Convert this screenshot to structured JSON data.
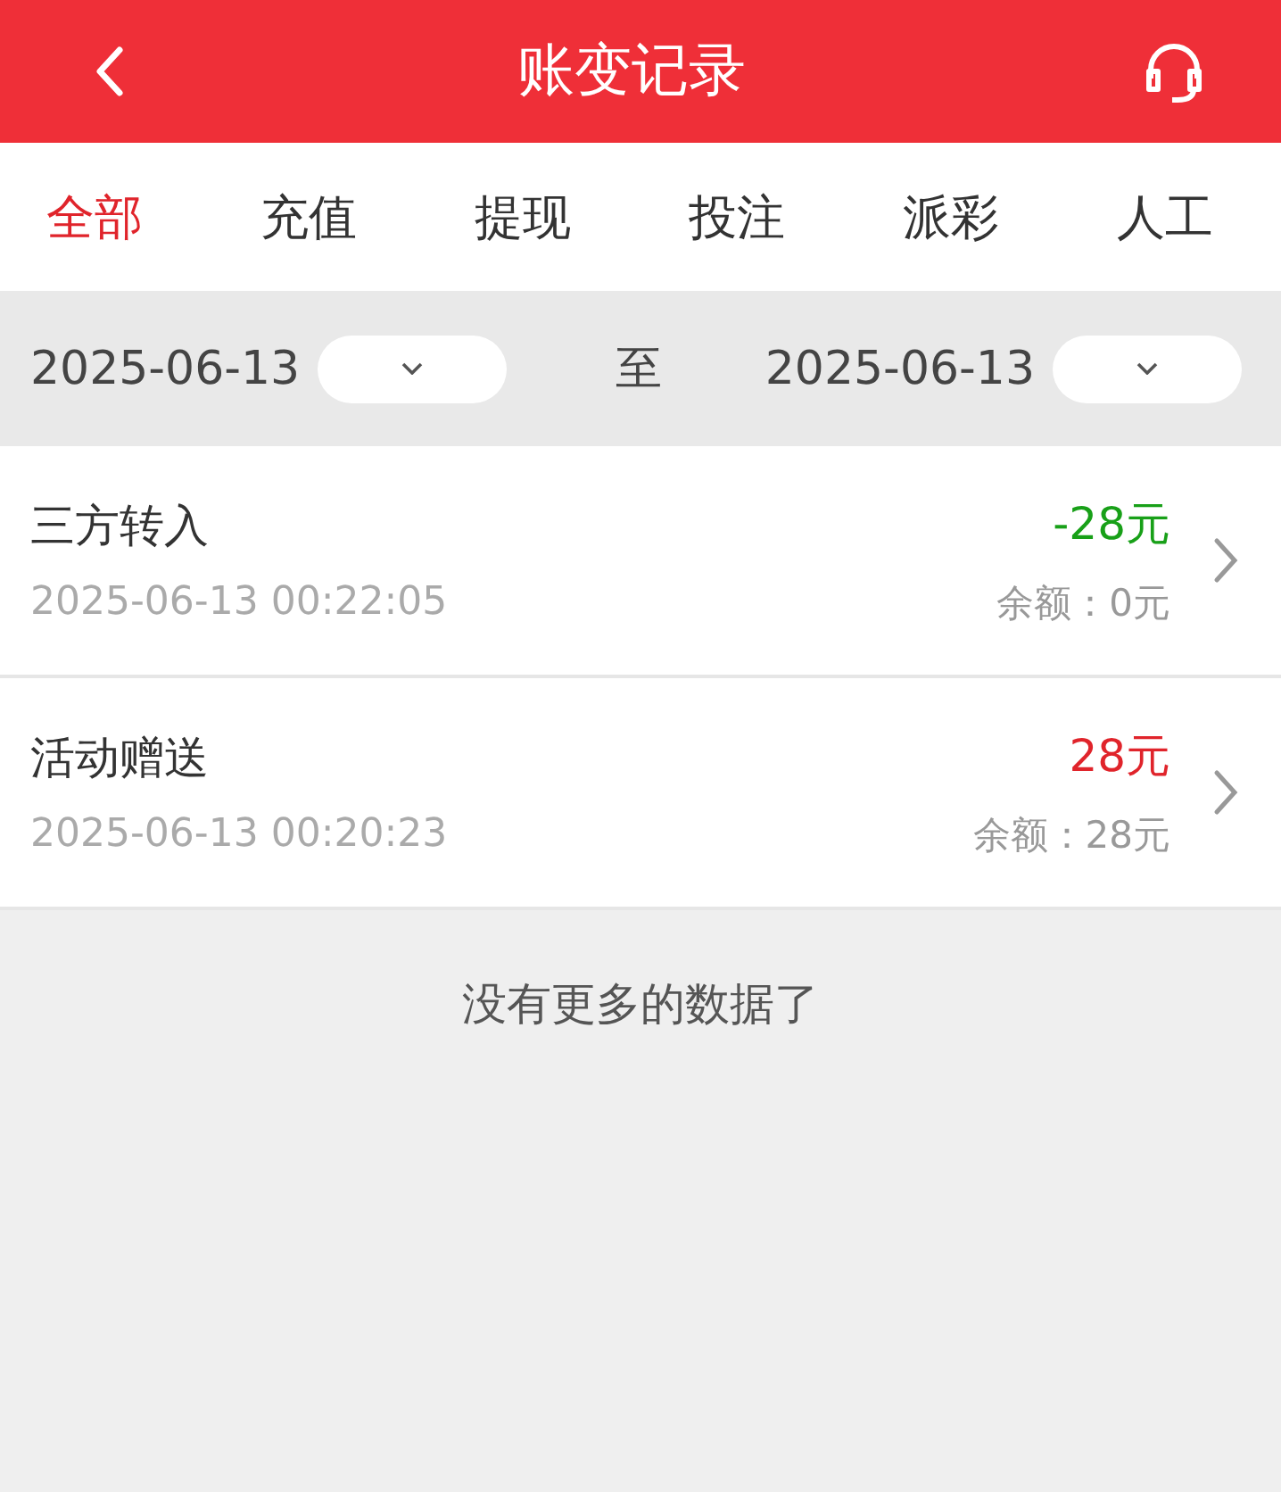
{
  "header": {
    "title": "账变记录"
  },
  "tabs": [
    {
      "label": "全部",
      "selected": true
    },
    {
      "label": "充值",
      "selected": false
    },
    {
      "label": "提现",
      "selected": false
    },
    {
      "label": "投注",
      "selected": false
    },
    {
      "label": "派彩",
      "selected": false
    },
    {
      "label": "人工",
      "selected": false
    }
  ],
  "filter": {
    "start_date": "2025-06-13",
    "separator": "至",
    "end_date": "2025-06-13"
  },
  "records": [
    {
      "title": "三方转入",
      "time": "2025-06-13 00:22:05",
      "amount": "-28元",
      "color": "#18a018",
      "balance": "余额：0元"
    },
    {
      "title": "活动赠送",
      "time": "2025-06-13 00:20:23",
      "amount": "28元",
      "color": "#e0242b",
      "balance": "余额：28元"
    }
  ],
  "footer": "没有更多的数据了"
}
